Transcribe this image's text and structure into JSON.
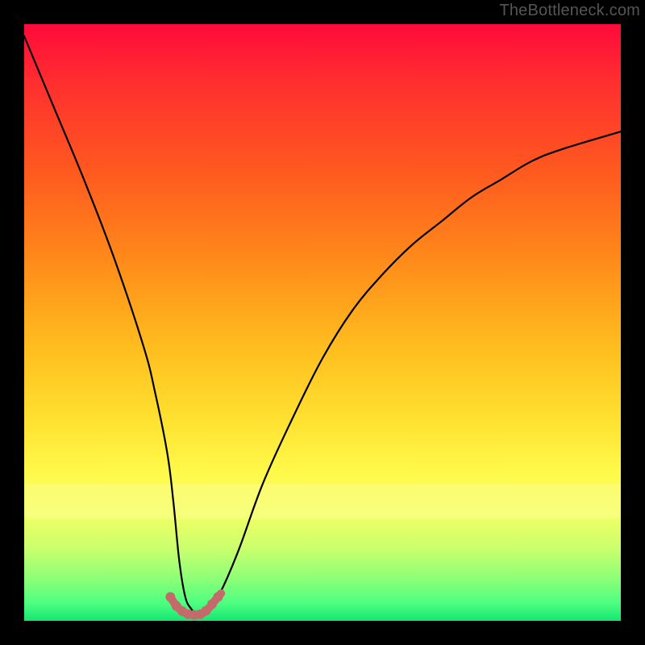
{
  "watermark": "TheBottleneck.com",
  "chart_data": {
    "type": "line",
    "title": "",
    "xlabel": "",
    "ylabel": "",
    "xlim": [
      0,
      100
    ],
    "ylim": [
      0,
      100
    ],
    "grid": false,
    "legend": false,
    "annotations": [],
    "background_gradient": {
      "top_color": "#ff0a3a",
      "bottom_color": "#14e673",
      "stops": [
        "red",
        "orange",
        "yellow",
        "green"
      ]
    },
    "series": [
      {
        "name": "main-curve",
        "color": "#000000",
        "x": [
          0,
          5,
          10,
          15,
          20,
          22,
          24,
          25,
          26,
          27,
          28,
          29,
          30,
          31,
          33,
          36,
          40,
          45,
          50,
          55,
          60,
          65,
          70,
          75,
          80,
          85,
          90,
          100
        ],
        "values": [
          98,
          86,
          74,
          61,
          46,
          38,
          28,
          20,
          10,
          4,
          2,
          1,
          1,
          2,
          5,
          12,
          23,
          34,
          44,
          52,
          58,
          63,
          67,
          71,
          74,
          77,
          79,
          82
        ]
      },
      {
        "name": "bottom-marker-band",
        "color": "#c46a6a",
        "x": [
          24.5,
          25,
          25.5,
          26,
          26.5,
          27,
          27.5,
          28,
          28.5,
          29,
          29.5,
          30,
          30.5,
          31,
          31.5,
          32,
          32.5,
          33
        ],
        "values": [
          4.0,
          3.2,
          2.5,
          2.0,
          1.6,
          1.3,
          1.1,
          1.0,
          1.0,
          1.0,
          1.1,
          1.3,
          1.7,
          2.2,
          2.8,
          3.4,
          4.0,
          4.6
        ]
      }
    ]
  }
}
